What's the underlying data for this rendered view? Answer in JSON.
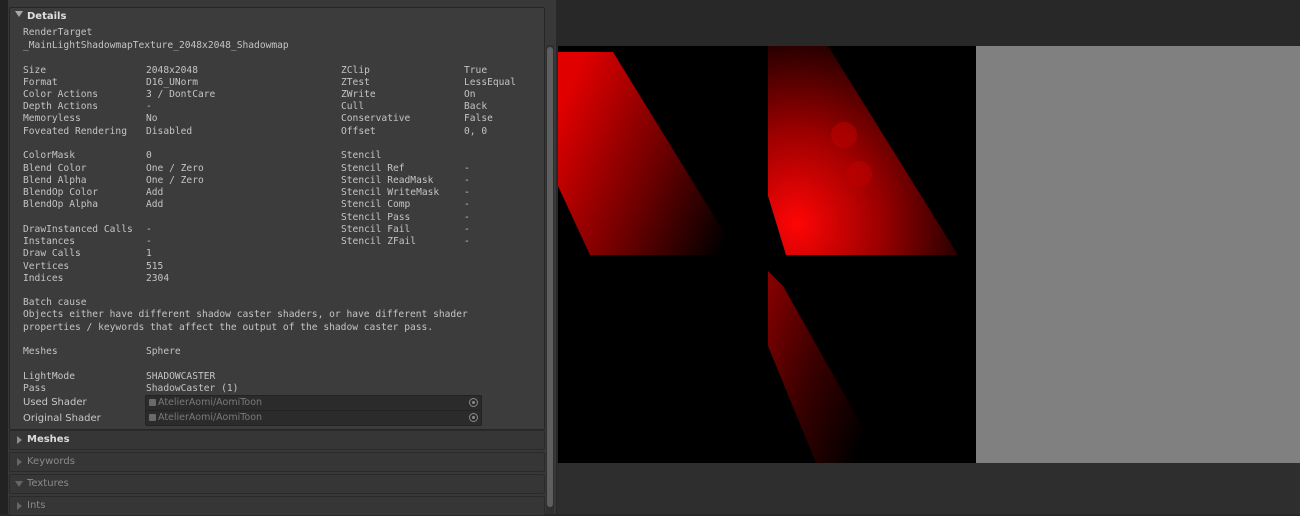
{
  "details": {
    "header": "Details",
    "target_label": "RenderTarget",
    "target_name": "_MainLightShadowmapTexture_2048x2048_Shadowmap",
    "left_col": [
      {
        "k": "Size",
        "v": "2048x2048"
      },
      {
        "k": "Format",
        "v": "D16_UNorm"
      },
      {
        "k": "Color Actions",
        "v": "3 / DontCare"
      },
      {
        "k": "Depth Actions",
        "v": "-"
      },
      {
        "k": "Memoryless",
        "v": "No"
      },
      {
        "k": "Foveated Rendering",
        "v": "Disabled"
      },
      {
        "k": "ColorMask",
        "v": "0"
      },
      {
        "k": "Blend Color",
        "v": "One / Zero"
      },
      {
        "k": "Blend Alpha",
        "v": "One / Zero"
      },
      {
        "k": "BlendOp Color",
        "v": "Add"
      },
      {
        "k": "BlendOp Alpha",
        "v": "Add"
      },
      {
        "k": "DrawInstanced Calls",
        "v": "-"
      },
      {
        "k": "Instances",
        "v": "-"
      },
      {
        "k": "Draw Calls",
        "v": "1"
      },
      {
        "k": "Vertices",
        "v": "515"
      },
      {
        "k": "Indices",
        "v": "2304"
      }
    ],
    "right_col": [
      {
        "k": "ZClip",
        "v": "True"
      },
      {
        "k": "ZTest",
        "v": "LessEqual"
      },
      {
        "k": "ZWrite",
        "v": "On"
      },
      {
        "k": "Cull",
        "v": "Back"
      },
      {
        "k": "Conservative",
        "v": "False"
      },
      {
        "k": "Offset",
        "v": "0, 0"
      },
      {
        "k": "Stencil",
        "v": ""
      },
      {
        "k": "Stencil Ref",
        "v": "-"
      },
      {
        "k": "Stencil ReadMask",
        "v": "-"
      },
      {
        "k": "Stencil WriteMask",
        "v": "-"
      },
      {
        "k": "Stencil Comp",
        "v": "-"
      },
      {
        "k": "Stencil Pass",
        "v": "-"
      },
      {
        "k": "Stencil Fail",
        "v": "-"
      },
      {
        "k": "Stencil ZFail",
        "v": "-"
      }
    ],
    "batch_cause_label": "Batch cause",
    "batch_cause_line1": "Objects either have different shadow caster shaders, or have different shader",
    "batch_cause_line2": "properties / keywords that affect the output of the shadow caster pass.",
    "meshes_label": "Meshes",
    "meshes_value": "Sphere",
    "lightmode_label": "LightMode",
    "lightmode_value": "SHADOWCASTER",
    "pass_label": "Pass",
    "pass_value": "ShadowCaster (1)",
    "used_shader_label": "Used Shader",
    "used_shader_value": "AtelierAomi/AomiToon",
    "original_shader_label": "Original Shader",
    "original_shader_value": "AtelierAomi/AomiToon"
  },
  "foldouts": [
    "Meshes",
    "Keywords",
    "Textures",
    "Ints"
  ],
  "colors": {
    "accent_red": "#ff0000",
    "viewport_grey": "#808080",
    "panel_bg": "#3c3c3c"
  }
}
